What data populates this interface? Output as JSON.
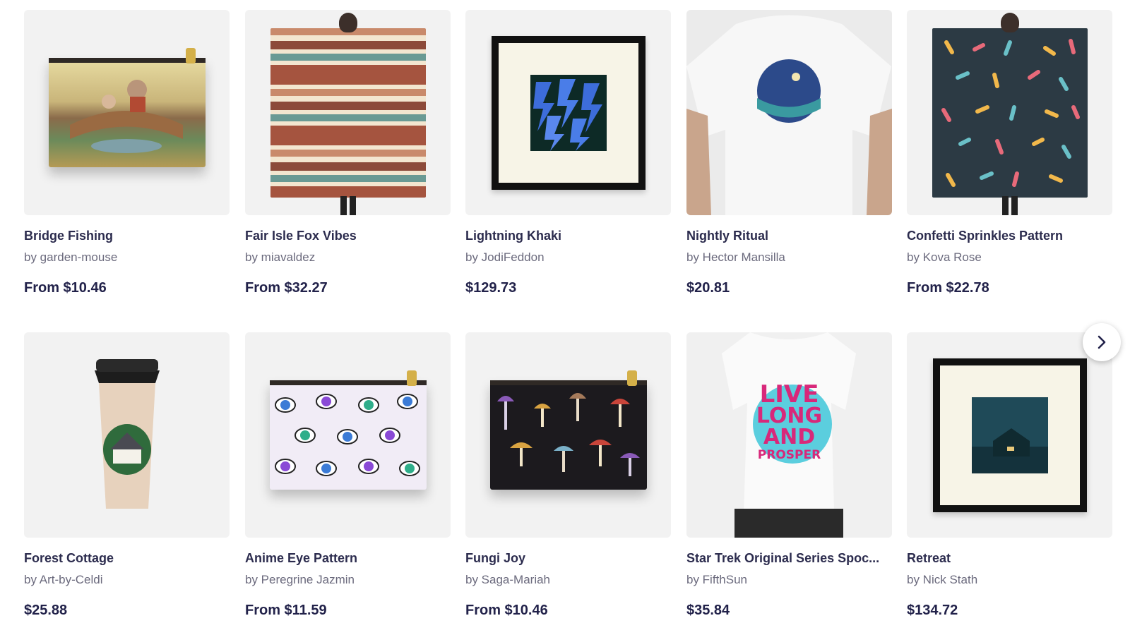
{
  "products": [
    {
      "title": "Bridge Fishing",
      "artist": "by garden-mouse",
      "price": "From $10.46"
    },
    {
      "title": "Fair Isle Fox Vibes",
      "artist": "by miavaldez",
      "price": "From $32.27"
    },
    {
      "title": "Lightning Khaki",
      "artist": "by JodiFeddon",
      "price": "$129.73"
    },
    {
      "title": "Nightly Ritual",
      "artist": "by Hector Mansilla",
      "price": "$20.81"
    },
    {
      "title": "Confetti Sprinkles Pattern",
      "artist": "by Kova Rose",
      "price": "From $22.78"
    },
    {
      "title": "Forest Cottage",
      "artist": "by Art-by-Celdi",
      "price": "$25.88"
    },
    {
      "title": "Anime Eye Pattern",
      "artist": "by Peregrine Jazmin",
      "price": "From $11.59"
    },
    {
      "title": "Fungi Joy",
      "artist": "by Saga-Mariah",
      "price": "From $10.46"
    },
    {
      "title": "Star Trek Original Series Spoc...",
      "artist": "by FifthSun",
      "price": "$35.84"
    },
    {
      "title": "Retreat",
      "artist": "by Nick Stath",
      "price": "$134.72"
    }
  ],
  "tshirt_print_text": [
    "LIVE",
    "LONG",
    "AND",
    "PROSPER"
  ],
  "icons": {
    "next": "chevron-right-icon"
  }
}
